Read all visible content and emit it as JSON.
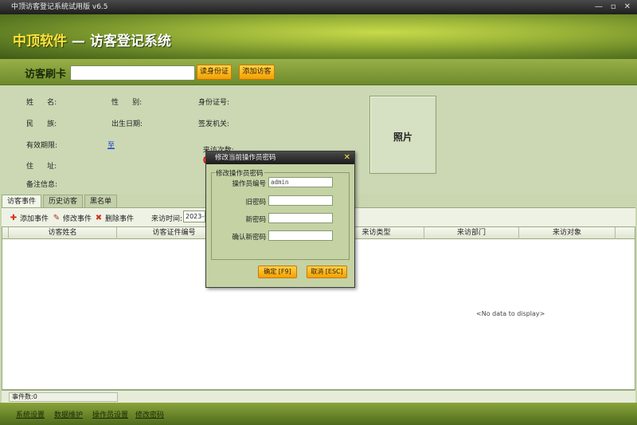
{
  "window": {
    "title": "中顶访客登记系统试用版 v6.5",
    "minimize_glyph": "—",
    "restore_glyph": "▫",
    "close_glyph": "✕"
  },
  "banner": {
    "brand": "中顶软件",
    "separator": "—",
    "title": "访客登记系统"
  },
  "card": {
    "label": "访客刷卡",
    "input_value": "",
    "read_id_button": "读身份证",
    "add_visitor_button": "添加访客"
  },
  "info": {
    "name_label": "姓      名:",
    "gender_label": "性      别:",
    "id_number_label": "身份证号:",
    "ethnicity_label": "民      族:",
    "birthdate_label": "出生日期:",
    "issuer_label": "签发机关:",
    "validity_label": "有效期限:",
    "validity_to": "至",
    "visit_count_label": "来访次数:",
    "visit_count_value": "0",
    "address_label": "住      址:",
    "remarks_label": "备注信息:",
    "photo_label": "照片"
  },
  "tabs": [
    {
      "label": "访客事件",
      "active": true
    },
    {
      "label": "历史访客",
      "active": false
    },
    {
      "label": "黑名单",
      "active": false
    }
  ],
  "toolbar": {
    "add_event": "添加事件",
    "edit_event": "修改事件",
    "delete_event": "删除事件",
    "visit_time_label": "来访时间:",
    "visit_time_value": "2023-0"
  },
  "grid": {
    "columns": [
      "访客姓名",
      "访客证件编号",
      "",
      "来访类型",
      "来访部门",
      "来访对象"
    ],
    "empty_text": "<No data to display>"
  },
  "status": {
    "event_count": "事件数:0"
  },
  "footer": {
    "links": [
      "系统设置",
      "数据维护",
      "操作员设置",
      "修改密码"
    ]
  },
  "dialog": {
    "title": "修改当前操作员密码",
    "close_glyph": "✕",
    "group_title": "修改操作员密码",
    "operator_id_label": "操作员编号",
    "operator_id_value": "admin",
    "old_password_label": "旧密码",
    "old_password_value": "",
    "new_password_label": "新密码",
    "new_password_value": "",
    "confirm_password_label": "确认新密码",
    "confirm_password_value": "",
    "ok_button": "确定 [F9]",
    "cancel_button": "取消 [ESC]"
  },
  "colors": {
    "accent_orange": "#f4a000",
    "brand_yellow": "#ffe23a",
    "visit_count_red": "#e02000",
    "header_green": "#6e8a2c"
  }
}
